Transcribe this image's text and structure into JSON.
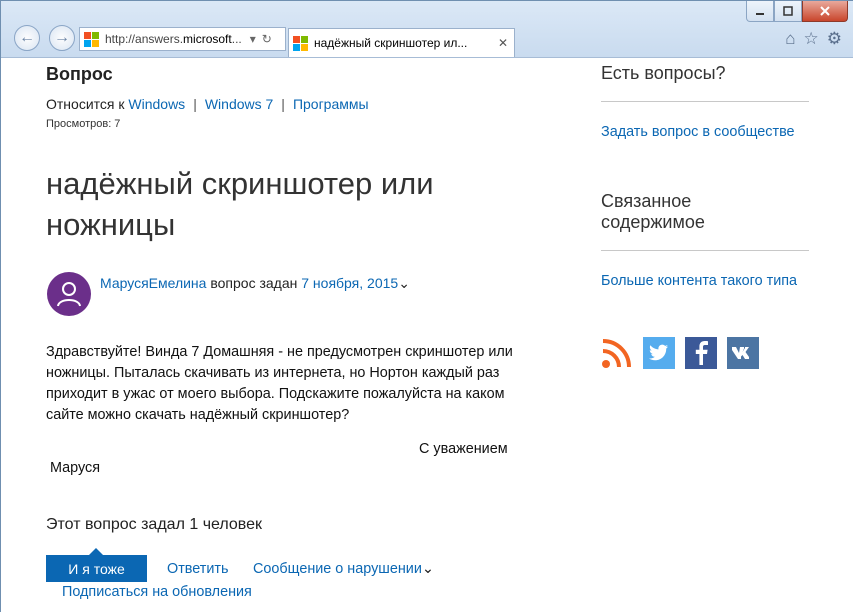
{
  "browser": {
    "address_prefix": "http://answers.",
    "address_domain": "microsoft",
    "address_suffix": "...",
    "tab_title": "надёжный скриншотер ил...",
    "back_icon": "back-arrow-icon",
    "forward_icon": "forward-arrow-icon"
  },
  "question": {
    "section_label": "Вопрос",
    "relates_label": "Относится к",
    "breadcrumbs": [
      "Windows",
      "Windows 7",
      "Программы"
    ],
    "views": "Просмотров: 7",
    "title": "надёжный скриншотер или ножницы",
    "author": "МарусяЕмелина",
    "asked_label": "вопрос задан",
    "date": "7 ноября, 2015",
    "body": "Здравствуйте!  Винда 7 Домашняя - не предусмотрен  скриншотер или ножницы. Пыталась скачивать из интернета, но Нортон каждый раз приходит в ужас от моего выбора.  Подскажите пожалуйста  на каком сайте можно скачать надёжный скриншотер?",
    "regards": "С уважением",
    "signature": "Маруся",
    "asked_count": "Этот вопрос задал 1 человек"
  },
  "actions": {
    "me_too": "И я тоже",
    "reply": "Ответить",
    "report": "Сообщение о нарушении",
    "subscribe": "Подписаться на обновления"
  },
  "sidebar": {
    "questions_heading": "Есть вопросы?",
    "ask_link": "Задать вопрос в сообществе",
    "related_heading_1": "Связанное",
    "related_heading_2": "содержимое",
    "more_link": "Больше контента такого типа"
  },
  "colors": {
    "link": "#0b67b3",
    "button": "#0b67b3",
    "avatar": "#6b2f8a",
    "rss": "#f26522",
    "twitter": "#55acee",
    "facebook": "#3b5998",
    "vk": "#4c75a3"
  }
}
